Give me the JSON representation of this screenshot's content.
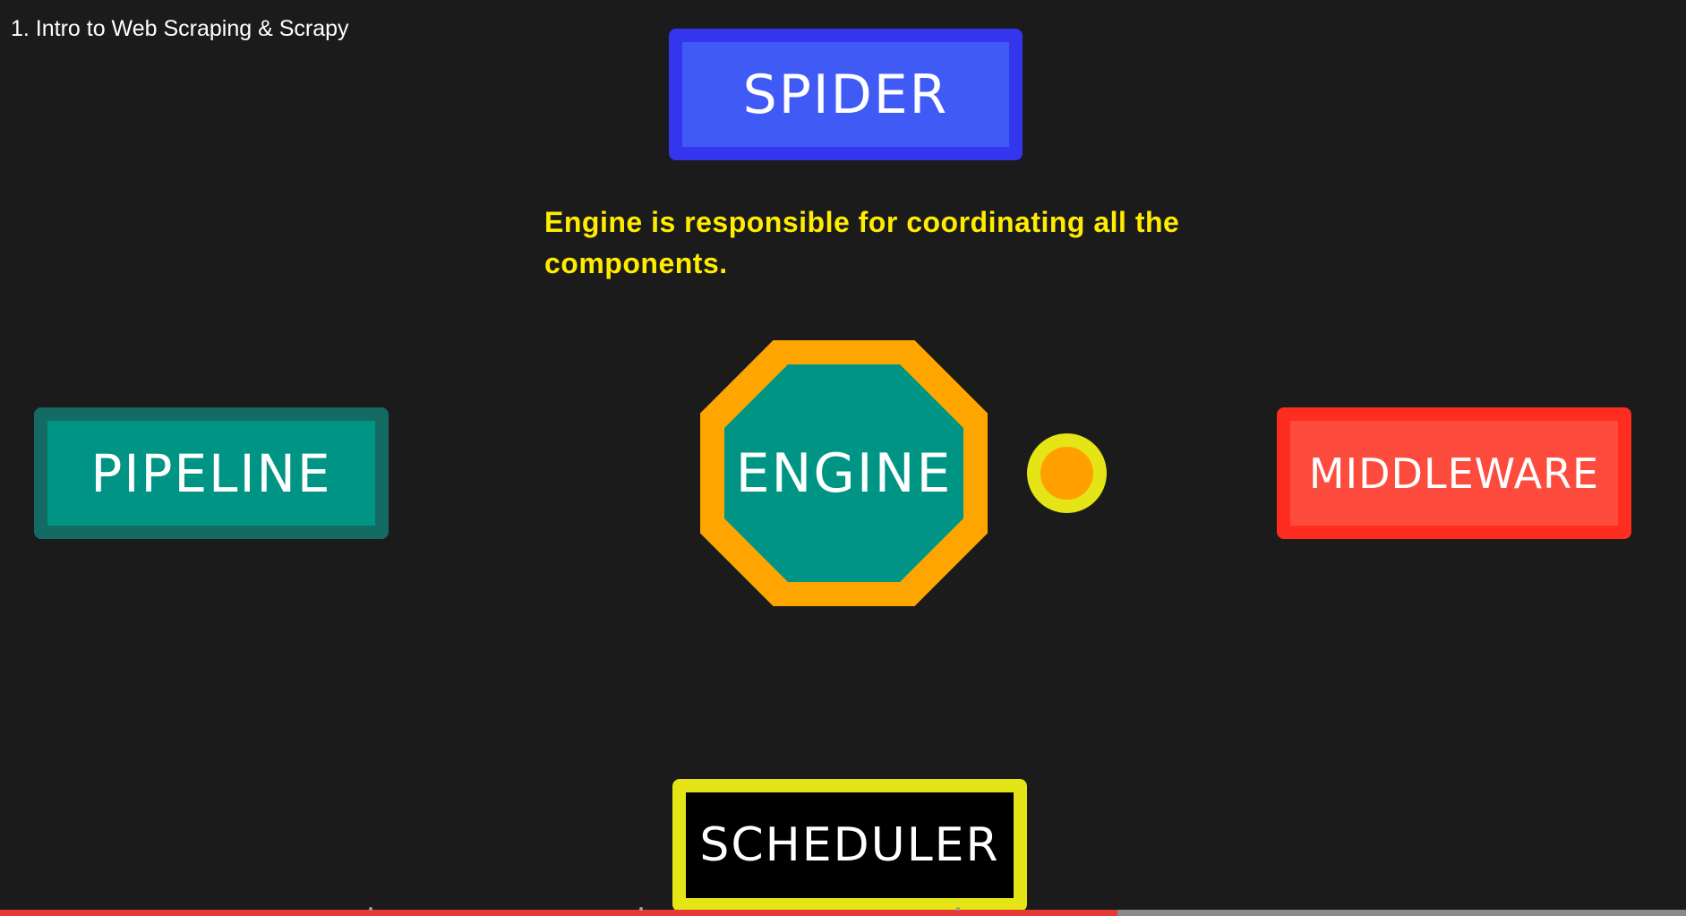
{
  "video": {
    "title": "1. Intro to Web Scraping & Scrapy"
  },
  "slide": {
    "caption": "Engine is responsible for coordinating all the components.",
    "components": {
      "spider": "SPIDER",
      "engine": "ENGINE",
      "pipeline": "PIPELINE",
      "middleware": "MIDDLEWARE",
      "scheduler": "SCHEDULER"
    },
    "colors": {
      "spider": "#3f5af5",
      "engine_fill": "#009485",
      "engine_border": "#ffa500",
      "pipeline": "#009485",
      "middleware": "#fd4c3d",
      "scheduler_border": "#e4e416",
      "caption": "#ffec00",
      "indicator_dot": "#ffa000"
    }
  },
  "player": {
    "progress_fraction": 0.663,
    "chapter_marker_fractions": [
      0.22,
      0.38,
      0.568
    ],
    "colors": {
      "played": "#e53935",
      "unplayed": "#8a8a8a"
    }
  }
}
